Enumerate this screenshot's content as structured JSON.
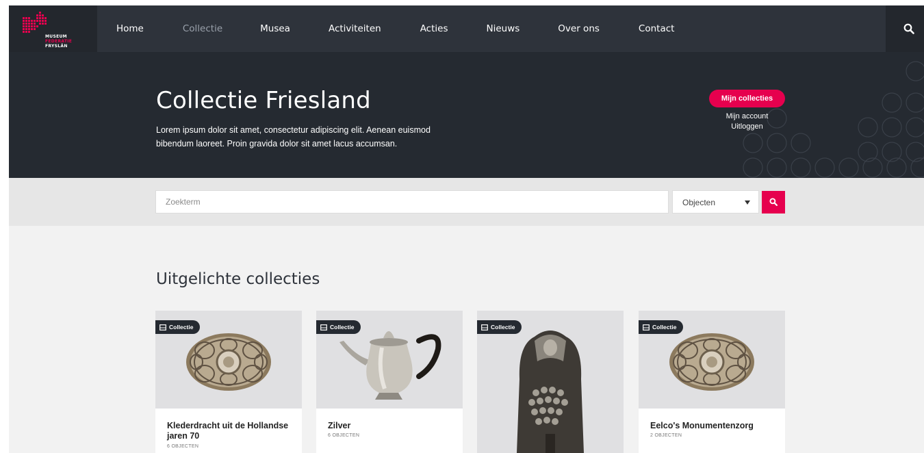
{
  "logo": {
    "line1": "MUSEUM",
    "line2": "FEDERATIE",
    "line3": "FRYSLÂN"
  },
  "nav": {
    "items": [
      {
        "label": "Home",
        "active": false
      },
      {
        "label": "Collectie",
        "active": true
      },
      {
        "label": "Musea",
        "active": false
      },
      {
        "label": "Activiteiten",
        "active": false
      },
      {
        "label": "Acties",
        "active": false
      },
      {
        "label": "Nieuws",
        "active": false
      },
      {
        "label": "Over ons",
        "active": false
      },
      {
        "label": "Contact",
        "active": false
      }
    ],
    "search_icon": "search-icon"
  },
  "hero": {
    "title": "Collectie Friesland",
    "description_line1": "Lorem ipsum dolor sit amet, consectetur adipiscing elit. Aenean euismod",
    "description_line2": "bibendum laoreet. Proin gravida dolor sit amet lacus accumsan.",
    "mijn_collecties": "Mijn collecties",
    "mijn_account": "Mijn account",
    "uitloggen": "Uitloggen"
  },
  "search": {
    "placeholder": "Zoekterm",
    "value": "",
    "select_value": "Objecten",
    "button_icon": "search-icon"
  },
  "featured": {
    "title": "Uitgelichte collecties",
    "badge_label": "Collectie",
    "cards": [
      {
        "title": "Klederdracht uit de Hollandse jaren 70",
        "count": "6 OBJECTEN",
        "image": "silver-brooch"
      },
      {
        "title": "Zilver",
        "count": "6 OBJECTEN",
        "image": "silver-teapot"
      },
      {
        "title": "",
        "count": "",
        "image": "silver-ornament"
      },
      {
        "title": "Eelco's Monumentenzorg",
        "count": "2 OBJECTEN",
        "image": "silver-brooch"
      }
    ]
  },
  "colors": {
    "nav_bg": "#2e333b",
    "hero_bg": "#252a31",
    "accent": "#e6004e",
    "band": "#e6e6e6",
    "main_bg": "#f2f2f2"
  }
}
